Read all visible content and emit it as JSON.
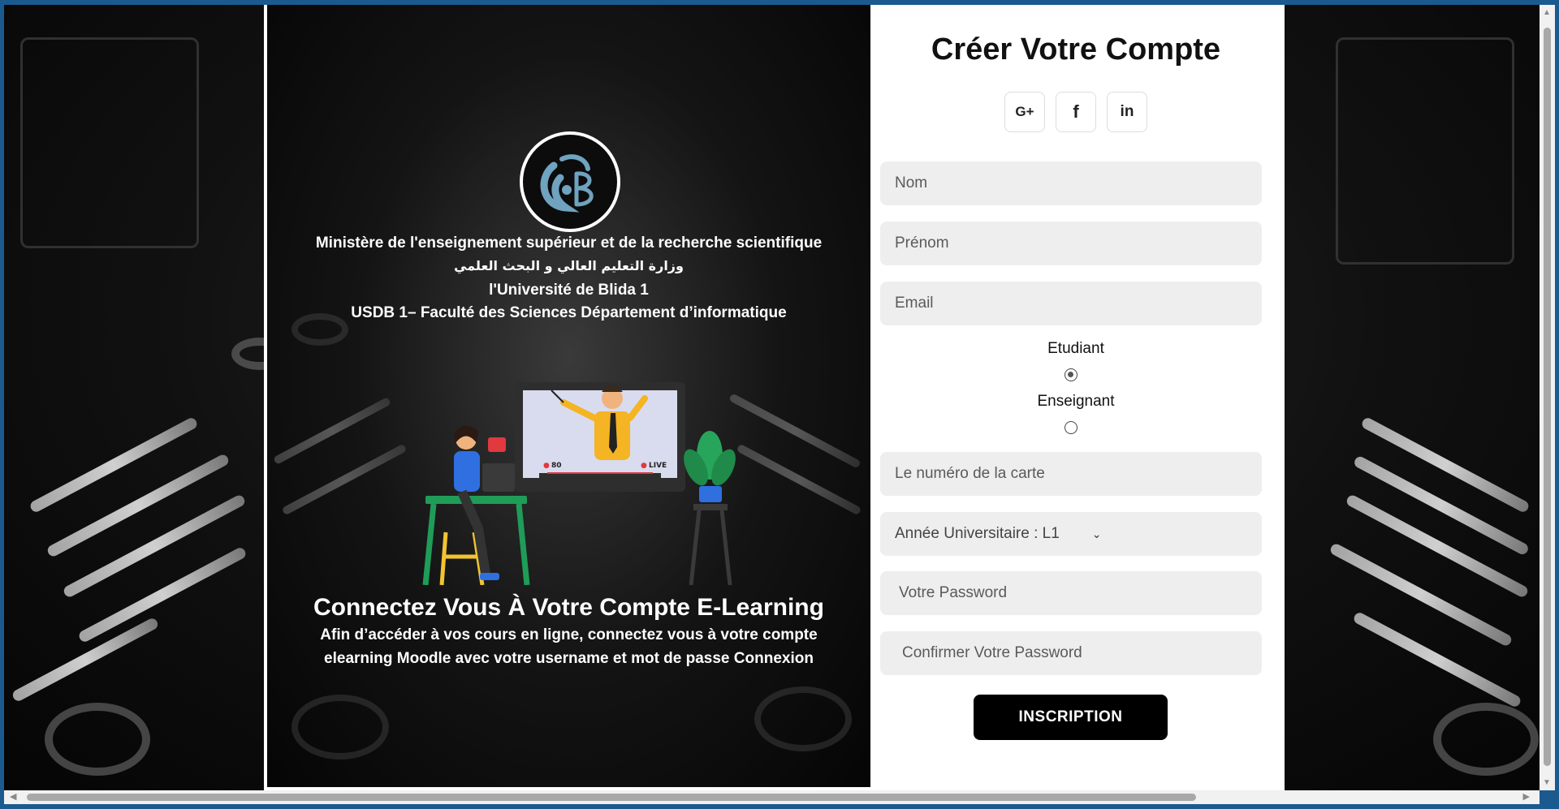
{
  "left": {
    "ministry": "Ministère de l'enseignement supérieur et de la recherche scientifique",
    "ministry_ar": "وزارة التعليم العالي و البحث العلمي",
    "university": "l'Université de Blida 1",
    "faculty": "USDB 1– Faculté des Sciences Département d’informatique",
    "headline": "Connectez Vous À Votre Compte E-Learning",
    "description": "Afin d’accéder à vos cours en ligne, connectez vous à votre compte elearning Moodle avec votre username et mot de passe Connexion",
    "illustration": {
      "viewer_count": "80",
      "live_label": "LIVE"
    }
  },
  "form": {
    "title": "Créer Votre Compte",
    "socials": [
      {
        "label": "G+",
        "icon": "google-plus-icon"
      },
      {
        "label": "f",
        "icon": "facebook-icon"
      },
      {
        "label": "in",
        "icon": "linkedin-icon"
      }
    ],
    "fields": {
      "nom_placeholder": "Nom",
      "prenom_placeholder": "Prénom",
      "email_placeholder": "Email",
      "carte_placeholder": "Le numéro de la carte",
      "password_placeholder": "Votre Password",
      "confirm_placeholder": "Confirmer Votre Password"
    },
    "roles": {
      "etudiant": "Etudiant",
      "enseignant": "Enseignant",
      "selected": "Etudiant"
    },
    "year_select": {
      "label": "Année Universitaire : L1"
    },
    "submit_label": "INSCRIPTION"
  },
  "colors": {
    "page_frame": "#1b5a8f",
    "field_bg": "#eeeeee",
    "button_bg": "#000000",
    "logo_accent": "#6fa3bf"
  }
}
